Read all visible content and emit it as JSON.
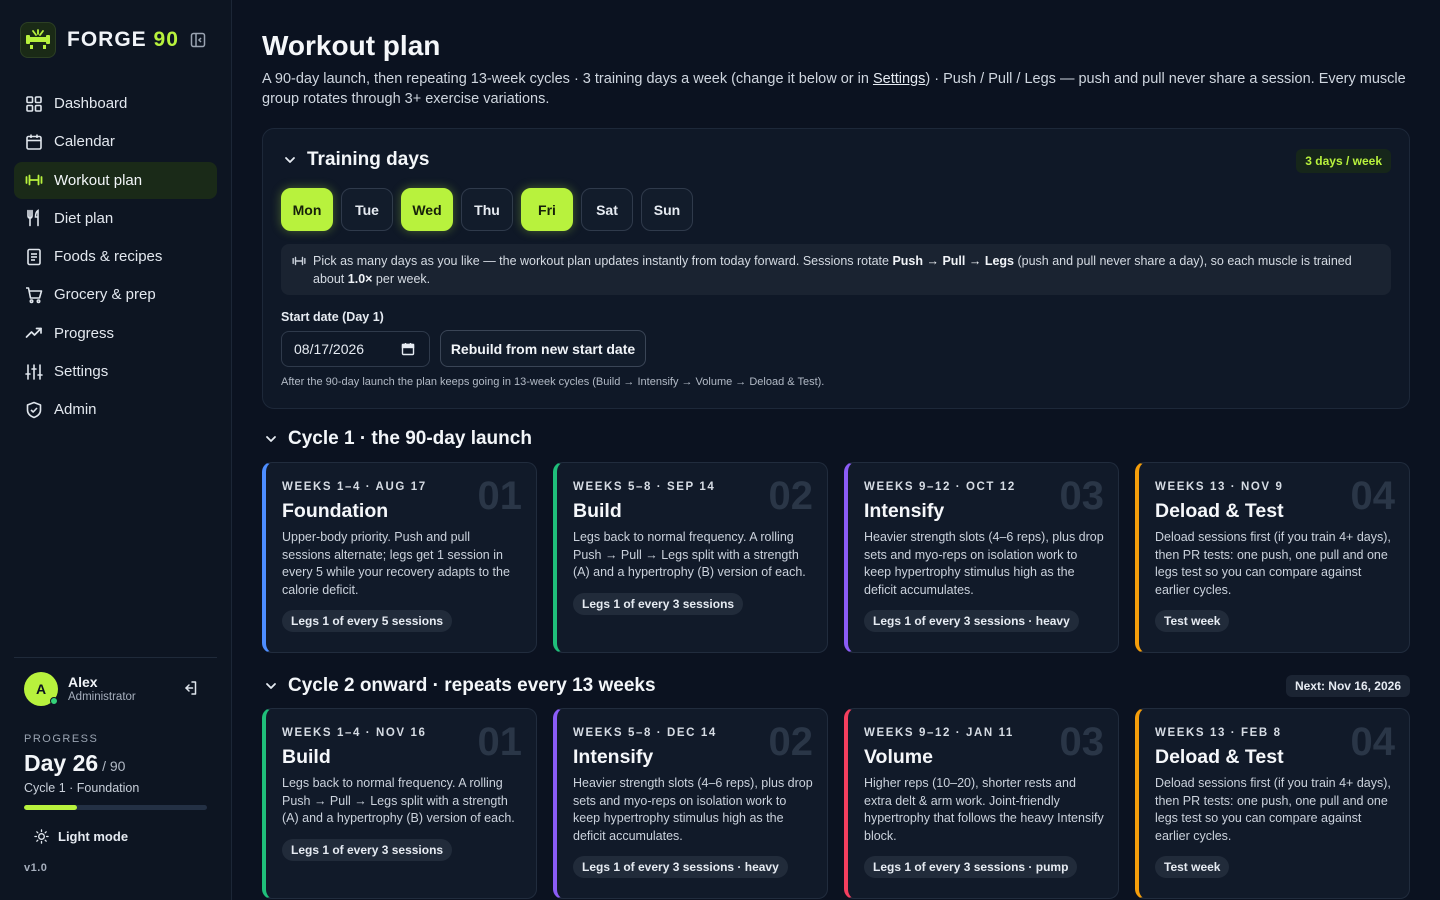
{
  "app": {
    "name_part1": "FORGE",
    "name_part2": "90",
    "accent": "#b8f23d"
  },
  "sidebar": {
    "items": [
      {
        "label": "Dashboard",
        "icon": "grid-icon"
      },
      {
        "label": "Calendar",
        "icon": "calendar-icon"
      },
      {
        "label": "Workout plan",
        "icon": "dumbbell-icon",
        "active": true
      },
      {
        "label": "Diet plan",
        "icon": "utensils-icon"
      },
      {
        "label": "Foods & recipes",
        "icon": "book-icon"
      },
      {
        "label": "Grocery & prep",
        "icon": "cart-icon"
      },
      {
        "label": "Progress",
        "icon": "trend-icon"
      },
      {
        "label": "Settings",
        "icon": "sliders-icon"
      },
      {
        "label": "Admin",
        "icon": "shield-icon"
      }
    ],
    "user": {
      "initial": "A",
      "name": "Alex",
      "role": "Administrator"
    },
    "progress": {
      "label": "PROGRESS",
      "day_prefix": "Day ",
      "day": "26",
      "of": " / 90",
      "fraction": 0.289,
      "cycle": "Cycle 1 · Foundation"
    },
    "theme_toggle": "Light mode",
    "version": "v1.0"
  },
  "page": {
    "title": "Workout plan",
    "desc_1": "A 90-day launch, then repeating 13-week cycles · 3 training days a week (change it below or in ",
    "desc_link": "Settings",
    "desc_2": ") · Push / Pull / Legs — push and pull never share a session. Every muscle group rotates through 3+ exercise variations."
  },
  "training": {
    "title": "Training days",
    "badge": "3 days / week",
    "days": [
      {
        "label": "Mon",
        "on": true
      },
      {
        "label": "Tue",
        "on": false
      },
      {
        "label": "Wed",
        "on": true
      },
      {
        "label": "Thu",
        "on": false
      },
      {
        "label": "Fri",
        "on": true
      },
      {
        "label": "Sat",
        "on": false
      },
      {
        "label": "Sun",
        "on": false
      }
    ],
    "info_1": "Pick as many days as you like — the workout plan updates instantly from today forward. Sessions rotate ",
    "info_rotation": "Push → Pull → Legs",
    "info_2": " (push and pull never share a day), so each muscle is trained about ",
    "info_freq": "1.0×",
    "info_3": " per week.",
    "start_label": "Start date (Day 1)",
    "start_value": "08/17/2026",
    "rebuild_label": "Rebuild from new start date",
    "note": "After the 90-day launch the plan keeps going in 13-week cycles (Build → Intensify → Volume → Deload & Test)."
  },
  "cycle1": {
    "title": "Cycle 1 · the 90-day launch",
    "phases": [
      {
        "meta": "WEEKS 1–4 · AUG 17",
        "num": "01",
        "name": "Foundation",
        "desc": "Upper-body priority. Push and pull sessions alternate; legs get 1 session in every 5 while your recovery adapts to the calorie deficit.",
        "tag": "Legs 1 of every 5 sessions",
        "color": "#4d8dff"
      },
      {
        "meta": "WEEKS 5–8 · SEP 14",
        "num": "02",
        "name": "Build",
        "desc": "Legs back to normal frequency. A rolling Push → Pull → Legs split with a strength (A) and a hypertrophy (B) version of each.",
        "tag": "Legs 1 of every 3 sessions",
        "color": "#1fbf7a"
      },
      {
        "meta": "WEEKS 9–12 · OCT 12",
        "num": "03",
        "name": "Intensify",
        "desc": "Heavier strength slots (4–6 reps), plus drop sets and myo-reps on isolation work to keep hypertrophy stimulus high as the deficit accumulates.",
        "tag": "Legs 1 of every 3 sessions · heavy",
        "color": "#8b5cf6"
      },
      {
        "meta": "WEEKS 13 · NOV 9",
        "num": "04",
        "name": "Deload & Test",
        "desc": "Deload sessions first (if you train 4+ days), then PR tests: one push, one pull and one legs test so you can compare against earlier cycles.",
        "tag": "Test week",
        "color": "#f59e0b"
      }
    ]
  },
  "cycle2": {
    "title": "Cycle 2 onward · repeats every 13 weeks",
    "next": "Next: Nov 16, 2026",
    "phases": [
      {
        "meta": "WEEKS 1–4 · NOV 16",
        "num": "01",
        "name": "Build",
        "desc": "Legs back to normal frequency. A rolling Push → Pull → Legs split with a strength (A) and a hypertrophy (B) version of each.",
        "tag": "Legs 1 of every 3 sessions",
        "color": "#1fbf7a"
      },
      {
        "meta": "WEEKS 5–8 · DEC 14",
        "num": "02",
        "name": "Intensify",
        "desc": "Heavier strength slots (4–6 reps), plus drop sets and myo-reps on isolation work to keep hypertrophy stimulus high as the deficit accumulates.",
        "tag": "Legs 1 of every 3 sessions · heavy",
        "color": "#8b5cf6"
      },
      {
        "meta": "WEEKS 9–12 · JAN 11",
        "num": "03",
        "name": "Volume",
        "desc": "Higher reps (10–20), shorter rests and extra delt & arm work. Joint-friendly hypertrophy that follows the heavy Intensify block.",
        "tag": "Legs 1 of every 3 sessions · pump",
        "color": "#f43f5e"
      },
      {
        "meta": "WEEKS 13 · FEB 8",
        "num": "04",
        "name": "Deload & Test",
        "desc": "Deload sessions first (if you train 4+ days), then PR tests: one push, one pull and one legs test so you can compare against earlier cycles.",
        "tag": "Test week",
        "color": "#f59e0b"
      }
    ]
  }
}
